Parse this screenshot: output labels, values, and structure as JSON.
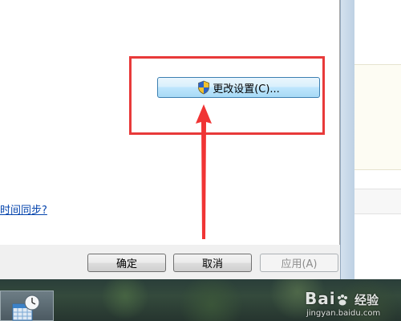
{
  "dialog": {
    "change_settings_label": "更改设置(C)...",
    "sync_link": "时间同步?"
  },
  "footer": {
    "ok_label": "确定",
    "cancel_label": "取消",
    "apply_label": "应用(A)"
  },
  "watermark": {
    "logo": "Bai",
    "logo_suffix": "经验",
    "url": "jingyan.baidu.com"
  },
  "colors": {
    "highlight": "#e83a3a",
    "link": "#0645ad",
    "button_accent": "#3c7fb1"
  }
}
